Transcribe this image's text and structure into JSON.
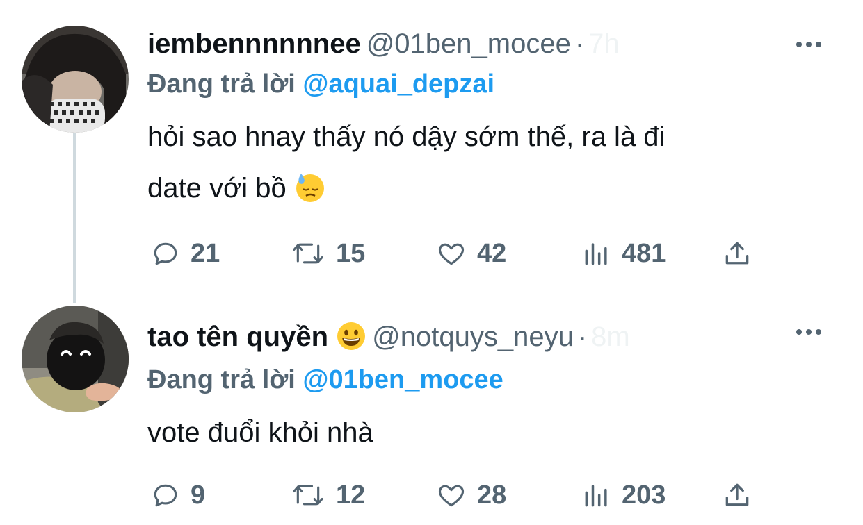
{
  "tweets": [
    {
      "author_name": "iembennnnnnee",
      "author_handle": "@01ben_mocee",
      "separator": "·",
      "time": "7h",
      "reply_label": "Đang trả lời",
      "reply_to": "@aquai_depzai",
      "text_line1": "hỏi sao hnay thấy nó dậy sớm thế, ra là đi",
      "text_line2": "date với bồ",
      "text_emoji": "downcast-face-with-sweat",
      "stats": {
        "replies": "21",
        "retweets": "15",
        "likes": "42",
        "views": "481"
      }
    },
    {
      "author_name": "tao tên quyền",
      "author_name_emoji": "grinning-face",
      "author_handle": "@notquys_neyu",
      "separator": "·",
      "time": "8m",
      "reply_label": "Đang trả lời",
      "reply_to": "@01ben_mocee",
      "text_line1": "vote đuổi khỏi nhà",
      "stats": {
        "replies": "9",
        "retweets": "12",
        "likes": "28",
        "views": "203"
      }
    }
  ],
  "icons": [
    "reply-icon",
    "retweet-icon",
    "like-icon",
    "views-icon",
    "share-icon",
    "more-icon"
  ],
  "colors": {
    "link": "#1d9bf0",
    "secondary": "#536471",
    "text": "#0f1419",
    "thread_line": "#cfd9de"
  }
}
